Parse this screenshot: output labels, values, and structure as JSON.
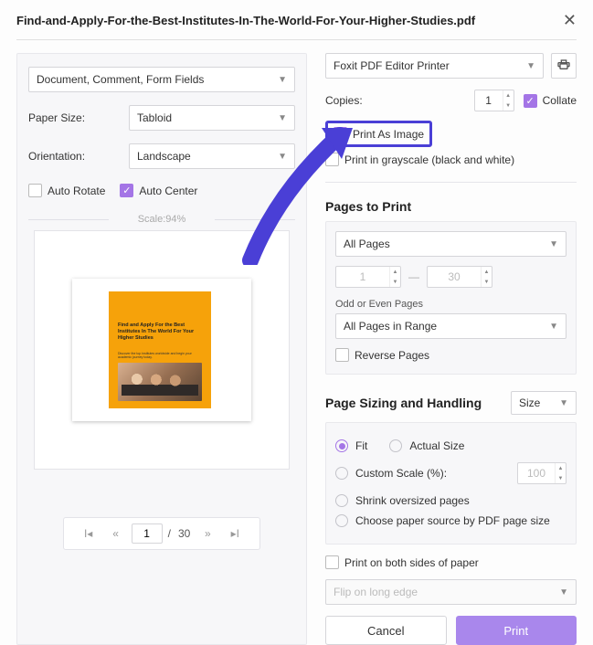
{
  "title": "Find-and-Apply-For-the-Best-Institutes-In-The-World-For-Your-Higher-Studies.pdf",
  "left": {
    "doc_select": "Document, Comment, Form Fields",
    "paper_size_lbl": "Paper Size:",
    "paper_size": "Tabloid",
    "orientation_lbl": "Orientation:",
    "orientation": "Landscape",
    "auto_rotate": "Auto Rotate",
    "auto_center": "Auto Center",
    "scale": "Scale:94%",
    "preview_headline": "Find and Apply For the Best Institutes In The World For Your Higher Studies",
    "preview_sub": "Discover the top institutes worldwide and begin your academic journey today.",
    "pager": {
      "page": "1",
      "total": "30"
    }
  },
  "right": {
    "printer": "Foxit PDF Editor Printer",
    "copies_lbl": "Copies:",
    "copies": "1",
    "collate": "Collate",
    "print_as_image": "Print As Image",
    "grayscale": "Print in grayscale (black and white)",
    "pages_h": "Pages to Print",
    "all_pages": "All Pages",
    "from": "1",
    "to": "30",
    "odd_even_lbl": "Odd or Even Pages",
    "odd_even": "All Pages in Range",
    "reverse": "Reverse Pages",
    "sizing_h": "Page Sizing and Handling",
    "size_btn": "Size",
    "fit": "Fit",
    "actual": "Actual Size",
    "custom": "Custom Scale (%):",
    "custom_val": "100",
    "shrink": "Shrink oversized pages",
    "choose_src": "Choose paper source by PDF page size",
    "duplex": "Print on both sides of paper",
    "flip": "Flip on long edge",
    "cancel": "Cancel",
    "print": "Print"
  }
}
